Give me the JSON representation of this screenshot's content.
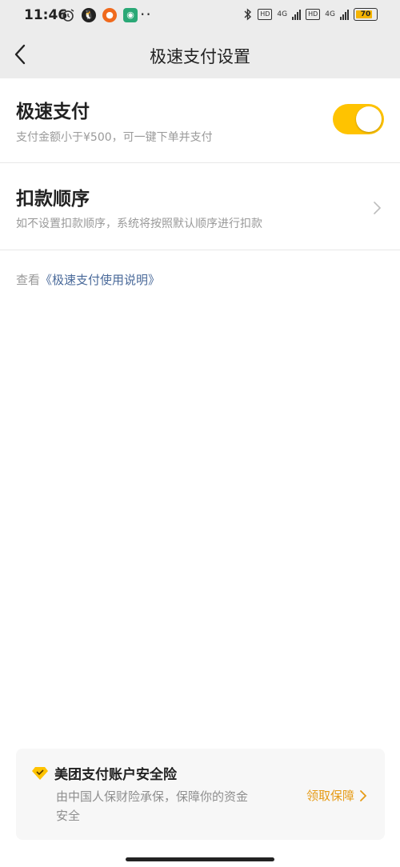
{
  "status_bar": {
    "time": "11:46",
    "battery": "70",
    "network_left": "4G",
    "network_right": "4G",
    "hd_left": "HD",
    "hd_right": "HD"
  },
  "nav": {
    "title": "极速支付设置"
  },
  "fast_pay": {
    "title": "极速支付",
    "subtitle": "支付金额小于¥500，可一键下单并支付",
    "enabled": true,
    "toggle_color": "#ffc300"
  },
  "deduction_order": {
    "title": "扣款顺序",
    "subtitle": "如不设置扣款顺序，系统将按照默认顺序进行扣款"
  },
  "help": {
    "prefix": "查看",
    "link_text": "《极速支付使用说明》"
  },
  "insurance": {
    "title": "美团支付账户安全险",
    "description": "由中国人保财险承保，保障你的资金安全",
    "action": "领取保障",
    "accent_color": "#e69b16"
  }
}
